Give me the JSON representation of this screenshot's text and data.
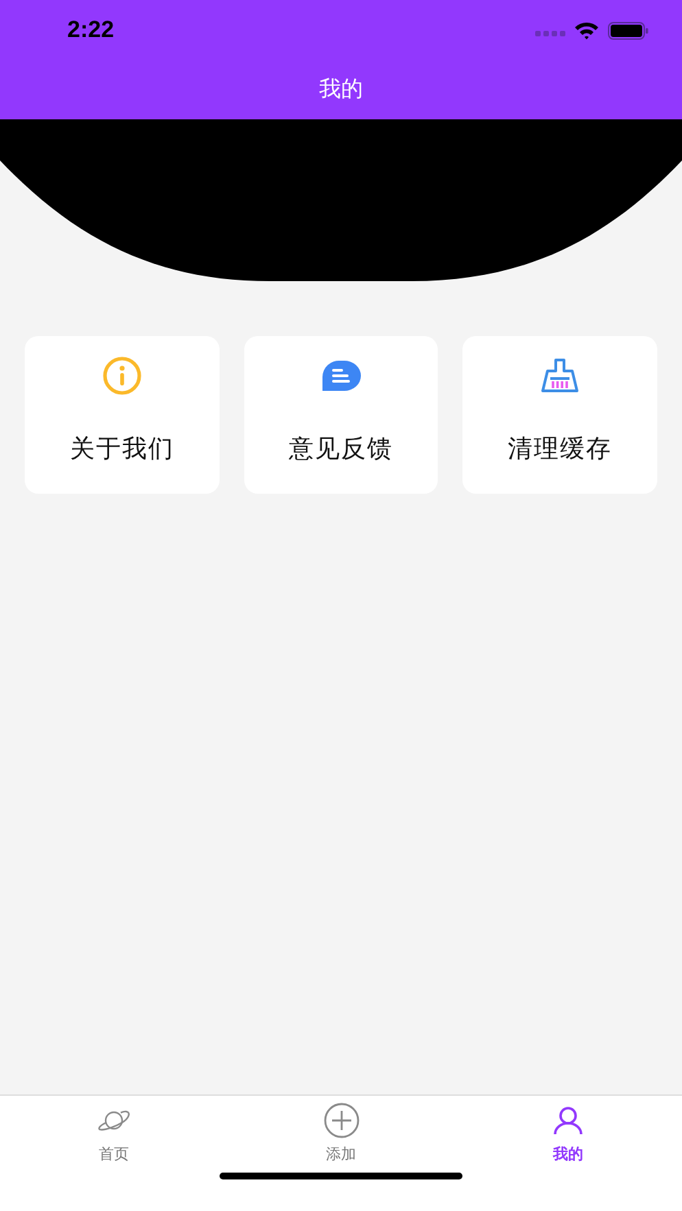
{
  "status_bar": {
    "time": "2:22"
  },
  "nav_bar": {
    "title": "我的"
  },
  "menu_cards": [
    {
      "kind": "info",
      "label": "关于我们"
    },
    {
      "kind": "message",
      "label": "意见反馈"
    },
    {
      "kind": "broom",
      "label": "清理缓存"
    }
  ],
  "tab_bar": [
    {
      "kind": "planet",
      "label": "首页",
      "selected": false
    },
    {
      "kind": "plus",
      "label": "添加",
      "selected": false
    },
    {
      "kind": "person",
      "label": "我的",
      "selected": true
    }
  ]
}
